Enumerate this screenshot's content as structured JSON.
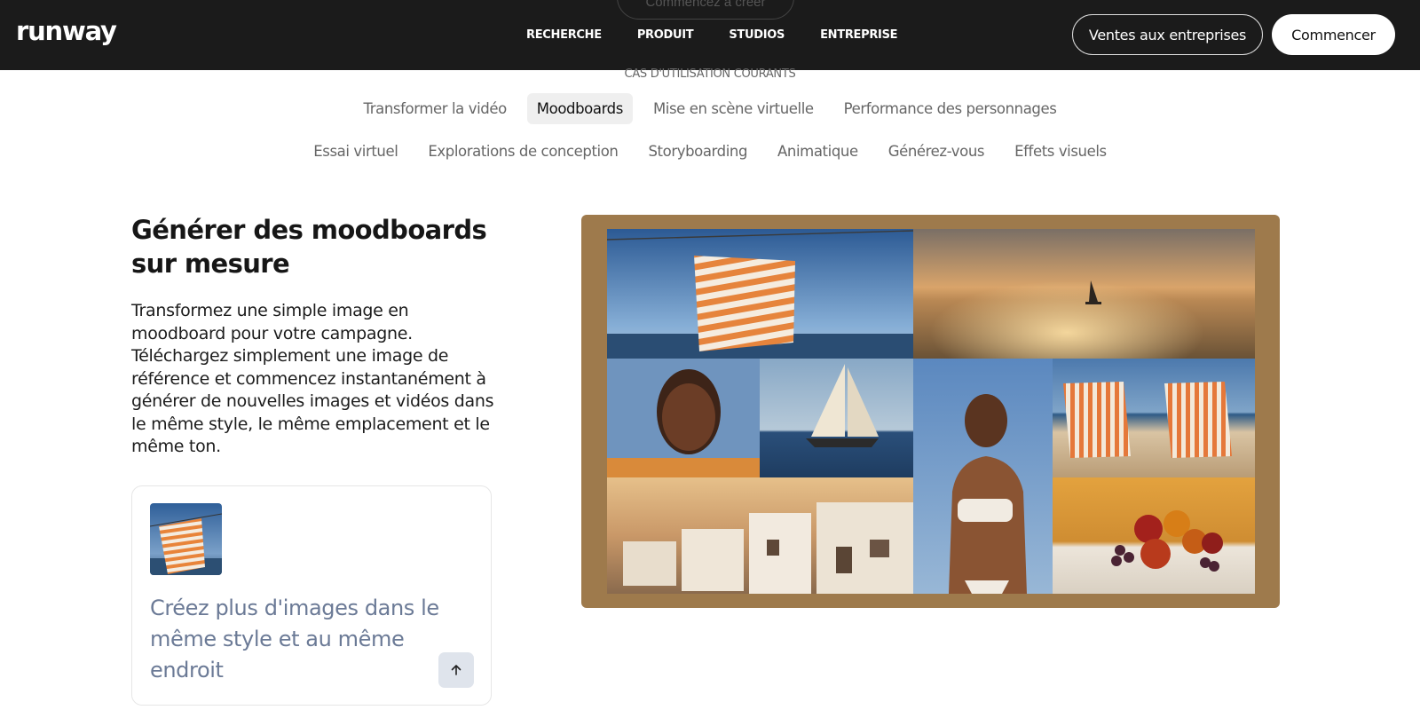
{
  "header": {
    "logo": "runway",
    "nav": [
      "RECHERCHE",
      "PRODUIT",
      "STUDIOS",
      "ENTREPRISE"
    ],
    "sales_label": "Ventes aux entreprises",
    "start_label": "Commencer",
    "ghost_label": "Commencez à créer"
  },
  "use_cases": {
    "label": "CAS D'UTILISATION COURANTS",
    "row1": [
      "Transformer la vidéo",
      "Moodboards",
      "Mise en scène virtuelle",
      "Performance des personnages"
    ],
    "row2": [
      "Essai virtuel",
      "Explorations de conception",
      "Storyboarding",
      "Animatique",
      "Générez-vous",
      "Effets visuels"
    ],
    "active": "Moodboards"
  },
  "feature": {
    "title": "Générer des moodboards sur mesure",
    "description": "Transformez une simple image en moodboard pour votre campagne. Téléchargez simplement une image de référence et commencez instantanément à générer de nouvelles images et vidéos dans le même style, le même emplacement et le même ton.",
    "prompt": "Créez plus d'images dans le même style et au même endroit"
  },
  "colors": {
    "header_bg": "#1b1b1b",
    "moodboard_frame": "#9e7a4c",
    "prompt_text": "#6b7a96"
  }
}
